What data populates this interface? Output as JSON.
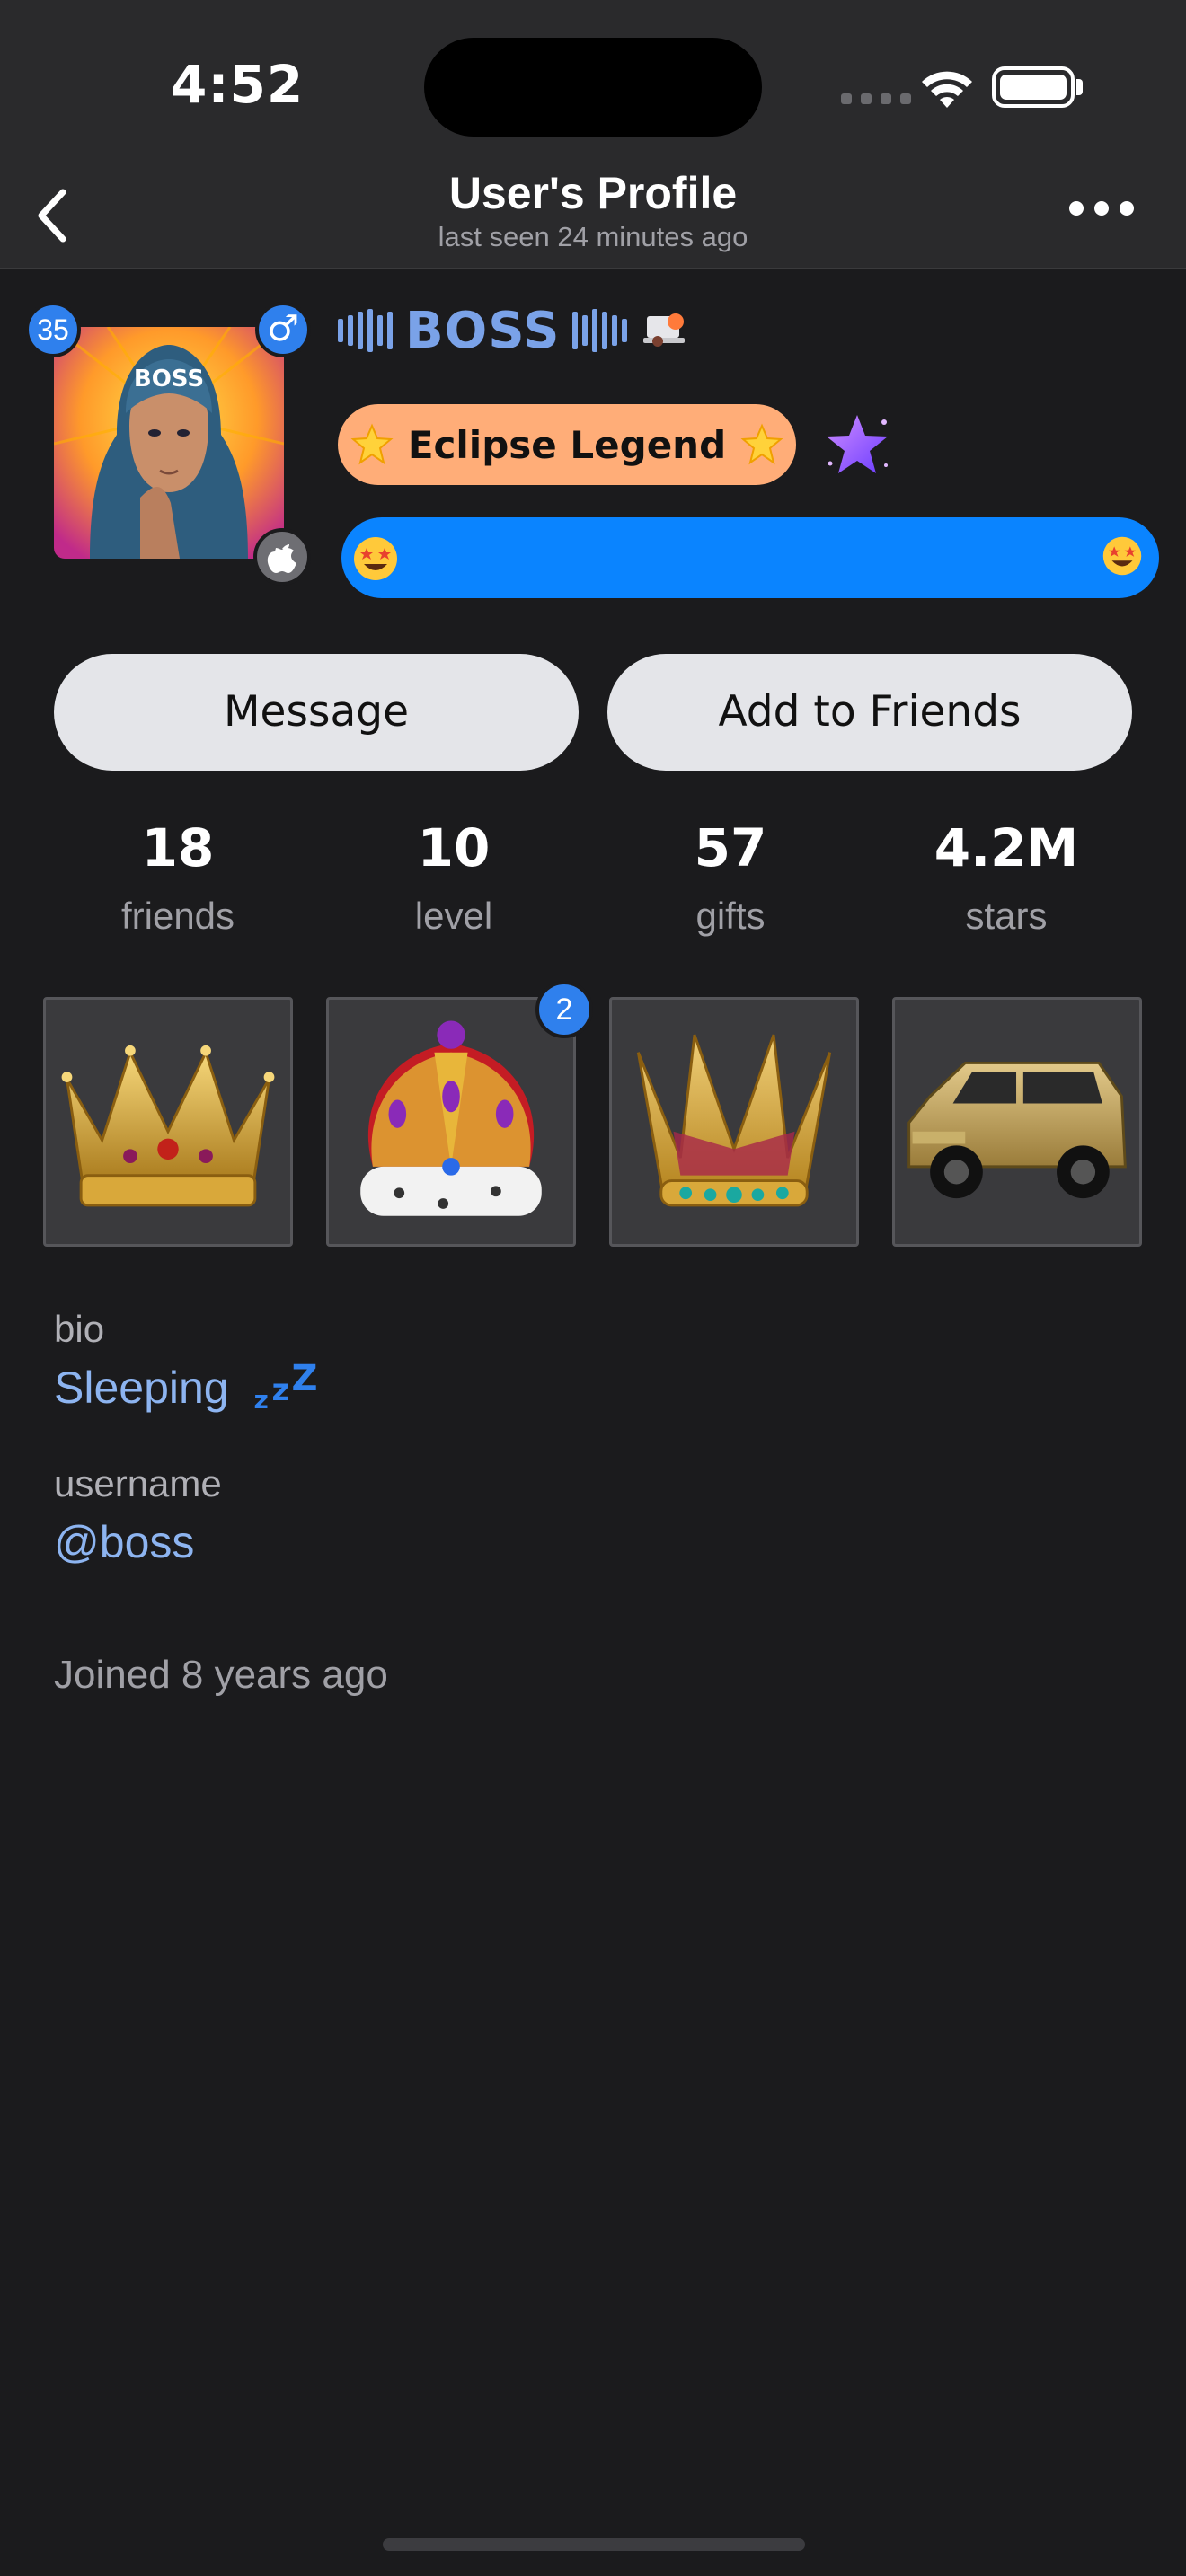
{
  "status_bar": {
    "time": "4:52"
  },
  "nav": {
    "title": "User's Profile",
    "subtitle": "last seen 24 minutes ago"
  },
  "profile": {
    "name": "BOSS",
    "level_badge": "35",
    "gender_symbol": "♂",
    "avatar_text": "BOSS",
    "title_badge": "Eclipse Legend",
    "colors": {
      "name": "#7aa2e8",
      "title_badge_bg": "#ffad78",
      "status_bar_bg": "#0a84ff",
      "accent": "#2f80ed"
    }
  },
  "actions": {
    "message": "Message",
    "add_friend": "Add to Friends"
  },
  "stats": [
    {
      "value": "18",
      "label": "friends"
    },
    {
      "value": "10",
      "label": "level"
    },
    {
      "value": "57",
      "label": "gifts"
    },
    {
      "value": "4.2M",
      "label": "stars"
    }
  ],
  "gifts": [
    {
      "icon": "gold-crown-icon"
    },
    {
      "icon": "royal-crown-icon",
      "count": "2"
    },
    {
      "icon": "jeweled-crown-icon"
    },
    {
      "icon": "gold-suv-icon"
    }
  ],
  "info": {
    "bio_label": "bio",
    "bio_value": "Sleeping",
    "username_label": "username",
    "username_value": "@boss",
    "joined": "Joined 8 years ago"
  }
}
